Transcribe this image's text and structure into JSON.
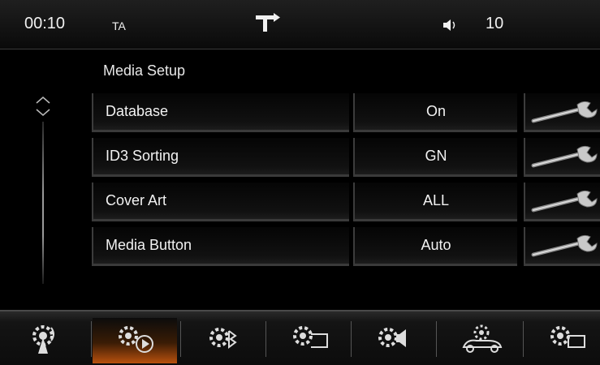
{
  "status": {
    "clock": "00:10",
    "ta_label": "TA",
    "volume": "10",
    "nav_icon": "turn-right-arrow-icon",
    "speaker_icon": "speaker-icon"
  },
  "page": {
    "title": "Media Setup"
  },
  "settings": [
    {
      "label": "Database",
      "value": "On"
    },
    {
      "label": "ID3 Sorting",
      "value": "GN"
    },
    {
      "label": "Cover Art",
      "value": "ALL"
    },
    {
      "label": "Media Button",
      "value": "Auto"
    }
  ],
  "bottom_bar": {
    "buttons": [
      {
        "icon": "radio-settings-icon",
        "active": false
      },
      {
        "icon": "media-settings-icon",
        "active": true
      },
      {
        "icon": "bluetooth-settings-icon",
        "active": false
      },
      {
        "icon": "display-settings-icon",
        "active": false
      },
      {
        "icon": "audio-settings-icon",
        "active": false
      },
      {
        "icon": "vehicle-settings-icon",
        "active": false
      },
      {
        "icon": "system-settings-icon",
        "active": false
      }
    ]
  },
  "colors": {
    "accent": "#b8510e",
    "background": "#000000",
    "text": "#f2f2f2"
  }
}
